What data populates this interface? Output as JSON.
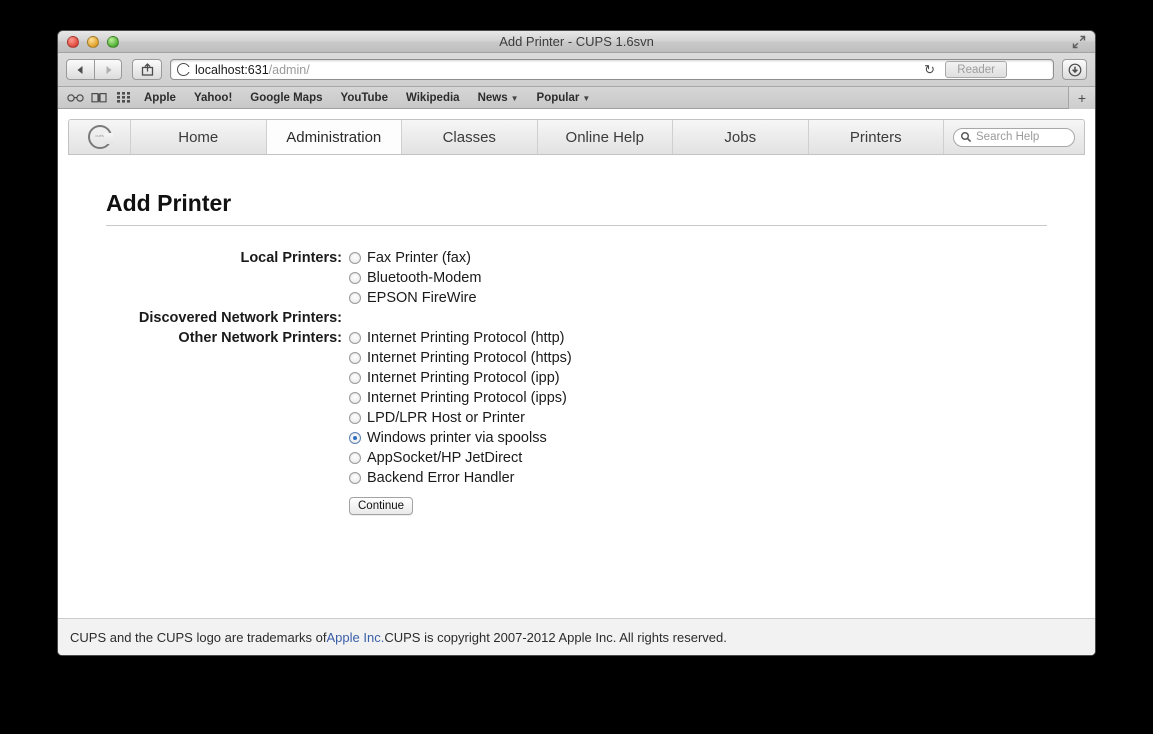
{
  "window": {
    "title": "Add Printer - CUPS 1.6svn",
    "fullscreen_icon": "expand-arrows-icon",
    "traffic_lights": [
      "close",
      "minimize",
      "zoom"
    ]
  },
  "toolbar": {
    "back_icon": "back-arrow-icon",
    "forward_icon": "forward-arrow-icon",
    "share_icon": "share-icon",
    "url_host": "localhost:631",
    "url_path": "/admin/",
    "reload_icon": "reload-icon",
    "reader_label": "Reader",
    "downloads_icon": "downloads-icon"
  },
  "bookmarks": {
    "icons": [
      "reading-list-icon",
      "bookmarks-icon",
      "top-sites-icon"
    ],
    "items": [
      {
        "label": "Apple",
        "menu": false
      },
      {
        "label": "Yahoo!",
        "menu": false
      },
      {
        "label": "Google Maps",
        "menu": false
      },
      {
        "label": "YouTube",
        "menu": false
      },
      {
        "label": "Wikipedia",
        "menu": false
      },
      {
        "label": "News",
        "menu": true
      },
      {
        "label": "Popular",
        "menu": true
      }
    ],
    "new_tab_label": "+"
  },
  "cups_nav": {
    "logo_text": "CUPS",
    "tabs": [
      {
        "label": "Home",
        "active": false
      },
      {
        "label": "Administration",
        "active": true
      },
      {
        "label": "Classes",
        "active": false
      },
      {
        "label": "Online Help",
        "active": false
      },
      {
        "label": "Jobs",
        "active": false
      },
      {
        "label": "Printers",
        "active": false
      }
    ],
    "search_placeholder": "Search Help",
    "search_value": ""
  },
  "page": {
    "title": "Add Printer",
    "groups": [
      {
        "label": "Local Printers:",
        "options": [
          {
            "label": "Fax Printer (fax)",
            "checked": false
          },
          {
            "label": "Bluetooth-Modem",
            "checked": false
          },
          {
            "label": "EPSON FireWire",
            "checked": false
          }
        ]
      },
      {
        "label": "Discovered Network Printers:",
        "options": []
      },
      {
        "label": "Other Network Printers:",
        "options": [
          {
            "label": "Internet Printing Protocol (http)",
            "checked": false
          },
          {
            "label": "Internet Printing Protocol (https)",
            "checked": false
          },
          {
            "label": "Internet Printing Protocol (ipp)",
            "checked": false
          },
          {
            "label": "Internet Printing Protocol (ipps)",
            "checked": false
          },
          {
            "label": "LPD/LPR Host or Printer",
            "checked": false
          },
          {
            "label": "Windows printer via spoolss",
            "checked": true
          },
          {
            "label": "AppSocket/HP JetDirect",
            "checked": false
          },
          {
            "label": "Backend Error Handler",
            "checked": false
          }
        ]
      }
    ],
    "continue_label": "Continue"
  },
  "footer": {
    "text_before": "CUPS and the CUPS logo are trademarks of ",
    "link": "Apple Inc.",
    "text_after": " CUPS is copyright 2007-2012 Apple Inc. All rights reserved."
  },
  "colors": {
    "accent": "#2f6fc4",
    "link": "#3a5fa8",
    "page_bg": "#ffffff",
    "chrome_bg": "#cfcfcf"
  }
}
